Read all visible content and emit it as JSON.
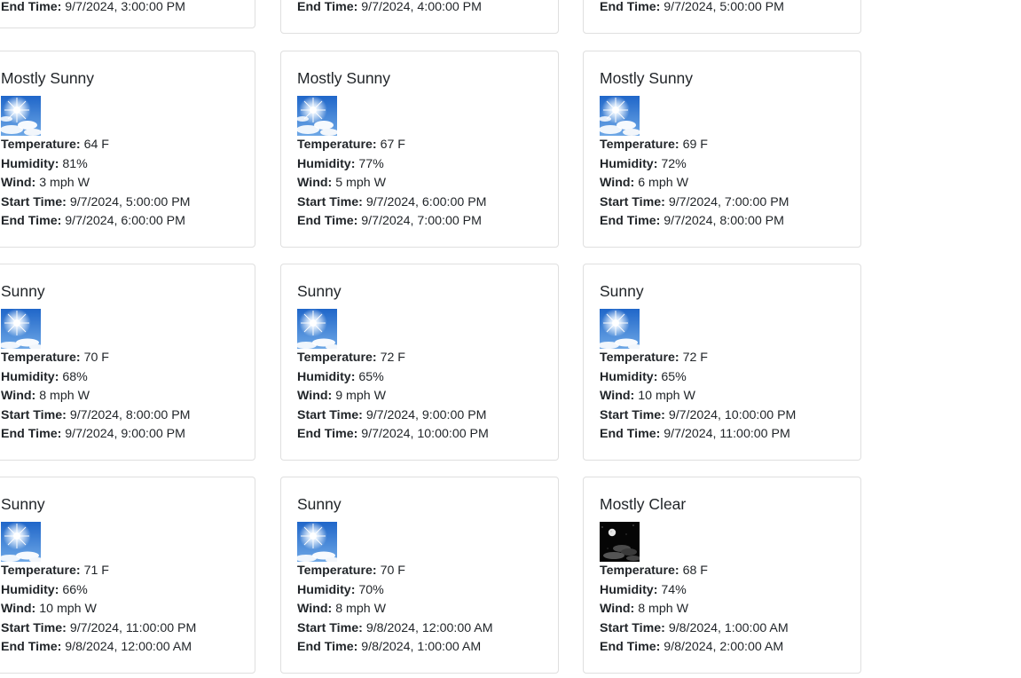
{
  "labels": {
    "temperature": "Temperature:",
    "humidity": "Humidity:",
    "wind": "Wind:",
    "start_time": "Start Time:",
    "end_time": "End Time:"
  },
  "top_row_end_times": [
    "9/7/2024, 3:00:00 PM",
    "9/7/2024, 4:00:00 PM",
    "9/7/2024, 5:00:00 PM"
  ],
  "forecasts": [
    {
      "title": "Mostly Sunny",
      "icon": "mostly-sunny-icon",
      "temperature": "64 F",
      "humidity": "81%",
      "wind": "3 mph W",
      "start": "9/7/2024, 5:00:00 PM",
      "end": "9/7/2024, 6:00:00 PM"
    },
    {
      "title": "Mostly Sunny",
      "icon": "mostly-sunny-icon",
      "temperature": "67 F",
      "humidity": "77%",
      "wind": "5 mph W",
      "start": "9/7/2024, 6:00:00 PM",
      "end": "9/7/2024, 7:00:00 PM"
    },
    {
      "title": "Mostly Sunny",
      "icon": "mostly-sunny-icon",
      "temperature": "69 F",
      "humidity": "72%",
      "wind": "6 mph W",
      "start": "9/7/2024, 7:00:00 PM",
      "end": "9/7/2024, 8:00:00 PM"
    },
    {
      "title": "Sunny",
      "icon": "sunny-icon",
      "temperature": "70 F",
      "humidity": "68%",
      "wind": "8 mph W",
      "start": "9/7/2024, 8:00:00 PM",
      "end": "9/7/2024, 9:00:00 PM"
    },
    {
      "title": "Sunny",
      "icon": "sunny-icon",
      "temperature": "72 F",
      "humidity": "65%",
      "wind": "9 mph W",
      "start": "9/7/2024, 9:00:00 PM",
      "end": "9/7/2024, 10:00:00 PM"
    },
    {
      "title": "Sunny",
      "icon": "sunny-icon",
      "temperature": "72 F",
      "humidity": "65%",
      "wind": "10 mph W",
      "start": "9/7/2024, 10:00:00 PM",
      "end": "9/7/2024, 11:00:00 PM"
    },
    {
      "title": "Sunny",
      "icon": "sunny-icon",
      "temperature": "71 F",
      "humidity": "66%",
      "wind": "10 mph W",
      "start": "9/7/2024, 11:00:00 PM",
      "end": "9/8/2024, 12:00:00 AM"
    },
    {
      "title": "Sunny",
      "icon": "sunny-icon",
      "temperature": "70 F",
      "humidity": "70%",
      "wind": "8 mph W",
      "start": "9/8/2024, 12:00:00 AM",
      "end": "9/8/2024, 1:00:00 AM"
    },
    {
      "title": "Mostly Clear",
      "icon": "mostly-clear-night-icon",
      "temperature": "68 F",
      "humidity": "74%",
      "wind": "8 mph W",
      "start": "9/8/2024, 1:00:00 AM",
      "end": "9/8/2024, 2:00:00 AM"
    }
  ]
}
